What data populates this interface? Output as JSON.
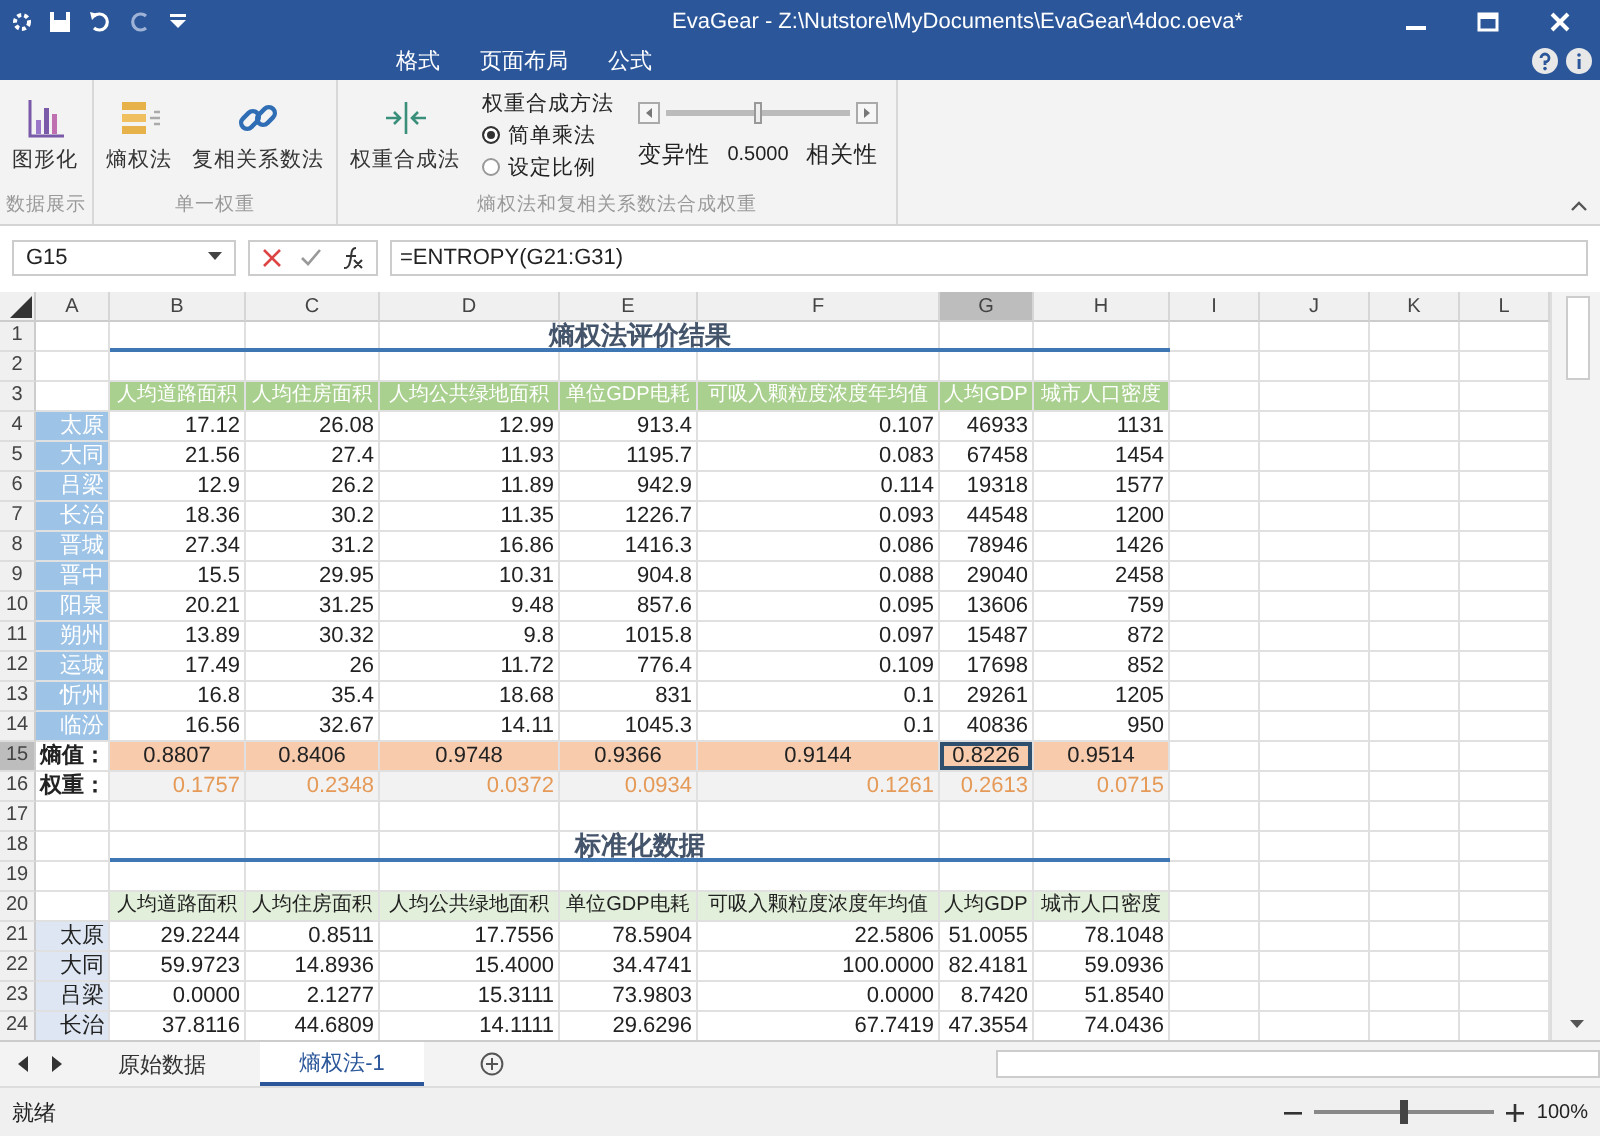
{
  "window": {
    "title": "EvaGear - Z:\\Nutstore\\MyDocuments\\EvaGear\\4doc.oeva*"
  },
  "menu_tabs": [
    {
      "label": "格式"
    },
    {
      "label": "页面布局"
    },
    {
      "label": "公式"
    }
  ],
  "ribbon": {
    "groups": [
      {
        "label": "数据展示",
        "buttons": [
          {
            "label": "图形化",
            "kind": "chart"
          }
        ]
      },
      {
        "label": "单一权重",
        "buttons": [
          {
            "label": "熵权法",
            "kind": "stack"
          },
          {
            "label": "复相关系数法",
            "kind": "link"
          }
        ]
      },
      {
        "label": "熵权法和复相关系数法合成权重",
        "buttons": [
          {
            "label": "权重合成法",
            "kind": "merge"
          }
        ],
        "method": {
          "title": "权重合成方法",
          "options": [
            {
              "label": "简单乘法",
              "selected": true
            },
            {
              "label": "设定比例",
              "selected": false
            }
          ]
        },
        "ratio": {
          "level": 0.5,
          "left": "变异性",
          "reading": "0.5000",
          "right": "相关性"
        }
      }
    ]
  },
  "formula_bar": {
    "cell": "G15",
    "formula": "=ENTROPY(G21:G31)"
  },
  "sheet": {
    "columns": [
      {
        "label": "A",
        "selected": false
      },
      {
        "label": "B",
        "selected": false
      },
      {
        "label": "C",
        "selected": false
      },
      {
        "label": "D",
        "selected": false
      },
      {
        "label": "E",
        "selected": false
      },
      {
        "label": "F",
        "selected": false
      },
      {
        "label": "G",
        "selected": true
      },
      {
        "label": "H",
        "selected": false
      },
      {
        "label": "I",
        "selected": false
      },
      {
        "label": "J",
        "selected": false
      },
      {
        "label": "K",
        "selected": false
      },
      {
        "label": "L",
        "selected": false
      }
    ],
    "rows": [
      {
        "number": "1",
        "selected": false,
        "kind": "title",
        "title": "熵权法评价结果"
      },
      {
        "number": "2",
        "selected": false,
        "kind": "blank"
      },
      {
        "number": "3",
        "selected": false,
        "kind": "header",
        "values": [
          "人均道路面积",
          "人均住房面积",
          "人均公共绿地面积",
          "单位GDP电耗",
          "可吸入颗粒度浓度年均值",
          "人均GDP",
          "城市人口密度"
        ]
      },
      {
        "number": "4",
        "selected": false,
        "kind": "data",
        "label": "太原",
        "values": [
          "17.12",
          "26.08",
          "12.99",
          "913.4",
          "0.107",
          "46933",
          "1131"
        ]
      },
      {
        "number": "5",
        "selected": false,
        "kind": "data",
        "label": "大同",
        "values": [
          "21.56",
          "27.4",
          "11.93",
          "1195.7",
          "0.083",
          "67458",
          "1454"
        ]
      },
      {
        "number": "6",
        "selected": false,
        "kind": "data",
        "label": "吕梁",
        "values": [
          "12.9",
          "26.2",
          "11.89",
          "942.9",
          "0.114",
          "19318",
          "1577"
        ]
      },
      {
        "number": "7",
        "selected": false,
        "kind": "data",
        "label": "长治",
        "values": [
          "18.36",
          "30.2",
          "11.35",
          "1226.7",
          "0.093",
          "44548",
          "1200"
        ]
      },
      {
        "number": "8",
        "selected": false,
        "kind": "data",
        "label": "晋城",
        "values": [
          "27.34",
          "31.2",
          "16.86",
          "1416.3",
          "0.086",
          "78946",
          "1426"
        ]
      },
      {
        "number": "9",
        "selected": false,
        "kind": "data",
        "label": "晋中",
        "values": [
          "15.5",
          "29.95",
          "10.31",
          "904.8",
          "0.088",
          "29040",
          "2458"
        ]
      },
      {
        "number": "10",
        "selected": false,
        "kind": "data",
        "label": "阳泉",
        "values": [
          "20.21",
          "31.25",
          "9.48",
          "857.6",
          "0.095",
          "13606",
          "759"
        ]
      },
      {
        "number": "11",
        "selected": false,
        "kind": "data",
        "label": "朔州",
        "values": [
          "13.89",
          "30.32",
          "9.8",
          "1015.8",
          "0.097",
          "15487",
          "872"
        ]
      },
      {
        "number": "12",
        "selected": false,
        "kind": "data",
        "label": "运城",
        "values": [
          "17.49",
          "26",
          "11.72",
          "776.4",
          "0.109",
          "17698",
          "852"
        ]
      },
      {
        "number": "13",
        "selected": false,
        "kind": "data",
        "label": "忻州",
        "values": [
          "16.8",
          "35.4",
          "18.68",
          "831",
          "0.1",
          "29261",
          "1205"
        ]
      },
      {
        "number": "14",
        "selected": false,
        "kind": "data",
        "label": "临汾",
        "values": [
          "16.56",
          "32.67",
          "14.11",
          "1045.3",
          "0.1",
          "40836",
          "950"
        ]
      },
      {
        "number": "15",
        "selected": true,
        "kind": "entropy",
        "label": "熵值：",
        "values": [
          "0.8807",
          "0.8406",
          "0.9748",
          "0.9366",
          "0.9144",
          "0.8226",
          "0.9514"
        ]
      },
      {
        "number": "16",
        "selected": false,
        "kind": "weight",
        "label": "权重：",
        "values": [
          "0.1757",
          "0.2348",
          "0.0372",
          "0.0934",
          "0.1261",
          "0.2613",
          "0.0715"
        ]
      },
      {
        "number": "17",
        "selected": false,
        "kind": "blank"
      },
      {
        "number": "18",
        "selected": false,
        "kind": "title",
        "title": "标准化数据"
      },
      {
        "number": "19",
        "selected": false,
        "kind": "blank"
      },
      {
        "number": "20",
        "selected": false,
        "kind": "header_light",
        "values": [
          "人均道路面积",
          "人均住房面积",
          "人均公共绿地面积",
          "单位GDP电耗",
          "可吸入颗粒度浓度年均值",
          "人均GDP",
          "城市人口密度"
        ]
      },
      {
        "number": "21",
        "selected": false,
        "kind": "data_std",
        "label": "太原",
        "values": [
          "29.2244",
          "0.8511",
          "17.7556",
          "78.5904",
          "22.5806",
          "51.0055",
          "78.1048"
        ]
      },
      {
        "number": "22",
        "selected": false,
        "kind": "data_std",
        "label": "大同",
        "values": [
          "59.9723",
          "14.8936",
          "15.4000",
          "34.4741",
          "100.0000",
          "82.4181",
          "59.0936"
        ]
      },
      {
        "number": "23",
        "selected": false,
        "kind": "data_std",
        "label": "吕梁",
        "values": [
          "0.0000",
          "2.1277",
          "15.3111",
          "73.9803",
          "0.0000",
          "8.7420",
          "51.8540"
        ]
      },
      {
        "number": "24",
        "selected": false,
        "kind": "data_std",
        "label": "长治",
        "values": [
          "37.8116",
          "44.6809",
          "14.1111",
          "29.6296",
          "67.7419",
          "47.3554",
          "74.0436"
        ]
      }
    ]
  },
  "sheet_tabs": [
    {
      "label": "原始数据",
      "selected": false
    },
    {
      "label": "熵权法-1",
      "selected": true
    }
  ],
  "status_bar": {
    "text": "就绪",
    "zoom": {
      "level": 0.5,
      "reading": "100%"
    }
  }
}
